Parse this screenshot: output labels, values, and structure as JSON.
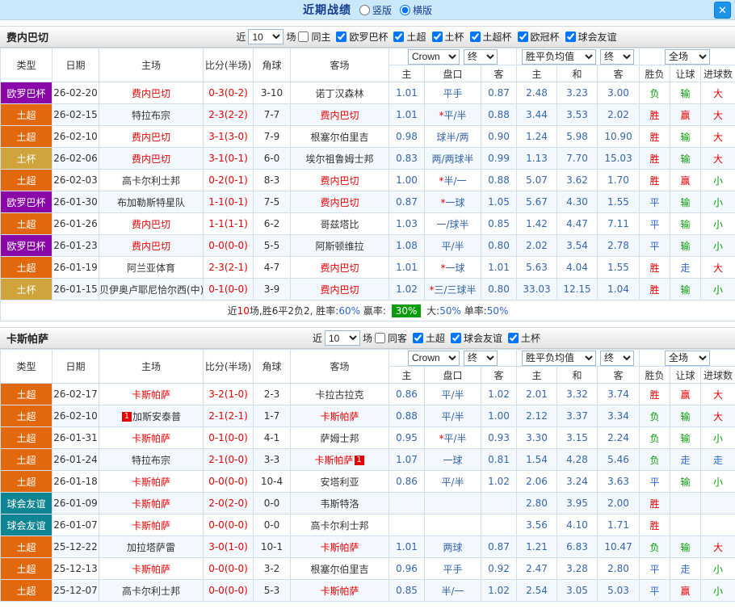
{
  "title_bar": {
    "title": "近期战绩",
    "radios": [
      {
        "label": "竖版",
        "selected": false
      },
      {
        "label": "横版",
        "selected": true
      }
    ],
    "close_glyph": "✕"
  },
  "colors": {
    "accent_blue": "#1e93ea",
    "comp_europa": "#8a08a8",
    "comp_super_lig": "#e2680e",
    "comp_cup": "#cfa43c",
    "comp_friendly": "#0f8594",
    "win_red": "#e60000",
    "lose_green": "#089b08",
    "draw_blue": "#3366cc"
  },
  "table_header": {
    "col_type": "类型",
    "col_date": "日期",
    "col_home": "主场",
    "col_score": "比分(半场)",
    "col_corner": "角球",
    "col_away": "客场",
    "dd_bookmaker": "Crown",
    "dd_final": "终",
    "dd_avg": "胜平负均值",
    "dd_full": "全场",
    "sub_home": "主",
    "sub_handicap": "盘口",
    "sub_away": "客",
    "sub_h": "主",
    "sub_d": "和",
    "sub_a": "客",
    "sub_result": "胜负",
    "sub_handi_result": "让球",
    "sub_goals": "进球数"
  },
  "sections": [
    {
      "team": "费内巴切",
      "filter": {
        "near_label": "近",
        "count": "10",
        "games_label": "场",
        "same_label": "同主",
        "same_checked": false,
        "comps": [
          "欧罗巴杯",
          "土超",
          "土杯",
          "土超杯",
          "欧冠杯",
          "球会友谊"
        ]
      },
      "rows": [
        {
          "comp": "欧罗巴杯",
          "date": "26-02-20",
          "home": "费内巴切",
          "home_hl": true,
          "home_badge": "",
          "home_badge_pos": "",
          "score": "0-3(0-2)",
          "corner": "3-10",
          "away": "诺丁汉森林",
          "away_hl": false,
          "away_badge": "",
          "away_badge_pos": "",
          "odds_home": "1.01",
          "handicap": "平手",
          "odds_away": "0.87",
          "avg_h": "2.48",
          "avg_d": "3.23",
          "avg_a": "3.00",
          "result": "负",
          "handi": "输",
          "goals": "大"
        },
        {
          "comp": "土超",
          "date": "26-02-15",
          "home": "特拉布宗",
          "home_hl": false,
          "home_badge": "",
          "home_badge_pos": "",
          "score": "2-3(2-2)",
          "corner": "7-7",
          "away": "费内巴切",
          "away_hl": true,
          "away_badge": "",
          "away_badge_pos": "",
          "odds_home": "1.01",
          "handicap": "*平/半",
          "odds_away": "0.88",
          "avg_h": "3.44",
          "avg_d": "3.53",
          "avg_a": "2.02",
          "result": "胜",
          "handi": "赢",
          "goals": "大"
        },
        {
          "comp": "土超",
          "date": "26-02-10",
          "home": "费内巴切",
          "home_hl": true,
          "home_badge": "",
          "home_badge_pos": "",
          "score": "3-1(3-0)",
          "corner": "7-9",
          "away": "根塞尔伯里吉",
          "away_hl": false,
          "away_badge": "",
          "away_badge_pos": "",
          "odds_home": "0.98",
          "handicap": "球半/两",
          "odds_away": "0.90",
          "avg_h": "1.24",
          "avg_d": "5.98",
          "avg_a": "10.90",
          "result": "胜",
          "handi": "输",
          "goals": "大"
        },
        {
          "comp": "土杯",
          "date": "26-02-06",
          "home": "费内巴切",
          "home_hl": true,
          "home_badge": "",
          "home_badge_pos": "",
          "score": "3-1(0-1)",
          "corner": "6-0",
          "away": "埃尔祖鲁姆士邦",
          "away_hl": false,
          "away_badge": "",
          "away_badge_pos": "",
          "odds_home": "0.83",
          "handicap": "两/两球半",
          "odds_away": "0.99",
          "avg_h": "1.13",
          "avg_d": "7.70",
          "avg_a": "15.03",
          "result": "胜",
          "handi": "输",
          "goals": "大"
        },
        {
          "comp": "土超",
          "date": "26-02-03",
          "home": "高卡尔利士邦",
          "home_hl": false,
          "home_badge": "",
          "home_badge_pos": "",
          "score": "0-2(0-1)",
          "corner": "8-3",
          "away": "费内巴切",
          "away_hl": true,
          "away_badge": "",
          "away_badge_pos": "",
          "odds_home": "1.00",
          "handicap": "*半/一",
          "odds_away": "0.88",
          "avg_h": "5.07",
          "avg_d": "3.62",
          "avg_a": "1.70",
          "result": "胜",
          "handi": "赢",
          "goals": "小"
        },
        {
          "comp": "欧罗巴杯",
          "date": "26-01-30",
          "home": "布加勒斯特星队",
          "home_hl": false,
          "home_badge": "",
          "home_badge_pos": "",
          "score": "1-1(0-1)",
          "corner": "7-5",
          "away": "费内巴切",
          "away_hl": true,
          "away_badge": "",
          "away_badge_pos": "",
          "odds_home": "0.87",
          "handicap": "*一球",
          "odds_away": "1.05",
          "avg_h": "5.67",
          "avg_d": "4.30",
          "avg_a": "1.55",
          "result": "平",
          "handi": "输",
          "goals": "小"
        },
        {
          "comp": "土超",
          "date": "26-01-26",
          "home": "费内巴切",
          "home_hl": true,
          "home_badge": "",
          "home_badge_pos": "",
          "score": "1-1(1-1)",
          "corner": "6-2",
          "away": "哥兹塔比",
          "away_hl": false,
          "away_badge": "",
          "away_badge_pos": "",
          "odds_home": "1.03",
          "handicap": "一/球半",
          "odds_away": "0.85",
          "avg_h": "1.42",
          "avg_d": "4.47",
          "avg_a": "7.11",
          "result": "平",
          "handi": "输",
          "goals": "小"
        },
        {
          "comp": "欧罗巴杯",
          "date": "26-01-23",
          "home": "费内巴切",
          "home_hl": true,
          "home_badge": "",
          "home_badge_pos": "",
          "score": "0-0(0-0)",
          "corner": "5-5",
          "away": "阿斯顿维拉",
          "away_hl": false,
          "away_badge": "",
          "away_badge_pos": "",
          "odds_home": "1.08",
          "handicap": "平/半",
          "odds_away": "0.80",
          "avg_h": "2.02",
          "avg_d": "3.54",
          "avg_a": "2.78",
          "result": "平",
          "handi": "输",
          "goals": "小"
        },
        {
          "comp": "土超",
          "date": "26-01-19",
          "home": "阿兰亚体育",
          "home_hl": false,
          "home_badge": "",
          "home_badge_pos": "",
          "score": "2-3(2-1)",
          "corner": "4-7",
          "away": "费内巴切",
          "away_hl": true,
          "away_badge": "",
          "away_badge_pos": "",
          "odds_home": "1.01",
          "handicap": "*一球",
          "odds_away": "1.01",
          "avg_h": "5.63",
          "avg_d": "4.04",
          "avg_a": "1.55",
          "result": "胜",
          "handi": "走",
          "goals": "大"
        },
        {
          "comp": "土杯",
          "date": "26-01-15",
          "home": "贝伊奥卢耶尼恰尔西(中)",
          "home_hl": false,
          "home_badge": "",
          "home_badge_pos": "",
          "score": "0-1(0-0)",
          "corner": "3-9",
          "away": "费内巴切",
          "away_hl": true,
          "away_badge": "",
          "away_badge_pos": "",
          "odds_home": "1.02",
          "handicap": "*三/三球半",
          "odds_away": "0.80",
          "avg_h": "33.03",
          "avg_d": "12.15",
          "avg_a": "1.04",
          "result": "胜",
          "handi": "输",
          "goals": "小"
        }
      ],
      "summary": [
        {
          "text": "近",
          "style": "plain"
        },
        {
          "text": "10",
          "style": "red"
        },
        {
          "text": "场,胜6平2负2, 胜率:",
          "style": "plain"
        },
        {
          "text": "60%",
          "style": "blue"
        },
        {
          "text": " 赢率: ",
          "style": "plain"
        },
        {
          "text": "30%",
          "style": "green-badge"
        },
        {
          "text": " 大:",
          "style": "plain"
        },
        {
          "text": "50%",
          "style": "blue"
        },
        {
          "text": " 单率:",
          "style": "plain"
        },
        {
          "text": "50%",
          "style": "blue"
        }
      ]
    },
    {
      "team": "卡斯帕萨",
      "filter": {
        "near_label": "近",
        "count": "10",
        "games_label": "场",
        "same_label": "同客",
        "same_checked": false,
        "comps": [
          "土超",
          "球会友谊",
          "土杯"
        ]
      },
      "rows": [
        {
          "comp": "土超",
          "date": "26-02-17",
          "home": "卡斯帕萨",
          "home_hl": true,
          "home_badge": "",
          "home_badge_pos": "",
          "score": "3-2(1-0)",
          "corner": "2-3",
          "away": "卡拉古拉克",
          "away_hl": false,
          "away_badge": "",
          "away_badge_pos": "",
          "odds_home": "0.86",
          "handicap": "平/半",
          "odds_away": "1.02",
          "avg_h": "2.01",
          "avg_d": "3.32",
          "avg_a": "3.74",
          "result": "胜",
          "handi": "赢",
          "goals": "大"
        },
        {
          "comp": "土超",
          "date": "26-02-10",
          "home": "加斯安泰普",
          "home_hl": false,
          "home_badge": "1",
          "home_badge_pos": "before",
          "score": "2-1(2-1)",
          "corner": "1-7",
          "away": "卡斯帕萨",
          "away_hl": true,
          "away_badge": "",
          "away_badge_pos": "",
          "odds_home": "0.88",
          "handicap": "平/半",
          "odds_away": "1.00",
          "avg_h": "2.12",
          "avg_d": "3.37",
          "avg_a": "3.34",
          "result": "负",
          "handi": "输",
          "goals": "大"
        },
        {
          "comp": "土超",
          "date": "26-01-31",
          "home": "卡斯帕萨",
          "home_hl": true,
          "home_badge": "",
          "home_badge_pos": "",
          "score": "0-1(0-0)",
          "corner": "4-1",
          "away": "萨姆士邦",
          "away_hl": false,
          "away_badge": "",
          "away_badge_pos": "",
          "odds_home": "0.95",
          "handicap": "*平/半",
          "odds_away": "0.93",
          "avg_h": "3.30",
          "avg_d": "3.15",
          "avg_a": "2.24",
          "result": "负",
          "handi": "输",
          "goals": "小"
        },
        {
          "comp": "土超",
          "date": "26-01-24",
          "home": "特拉布宗",
          "home_hl": false,
          "home_badge": "",
          "home_badge_pos": "",
          "score": "2-1(0-0)",
          "corner": "3-3",
          "away": "卡斯帕萨",
          "away_hl": true,
          "away_badge": "1",
          "away_badge_pos": "after",
          "odds_home": "1.07",
          "handicap": "一球",
          "odds_away": "0.81",
          "avg_h": "1.54",
          "avg_d": "4.28",
          "avg_a": "5.46",
          "result": "负",
          "handi": "走",
          "goals": "走"
        },
        {
          "comp": "土超",
          "date": "26-01-18",
          "home": "卡斯帕萨",
          "home_hl": true,
          "home_badge": "",
          "home_badge_pos": "",
          "score": "0-0(0-0)",
          "corner": "10-4",
          "away": "安塔利亚",
          "away_hl": false,
          "away_badge": "",
          "away_badge_pos": "",
          "odds_home": "0.86",
          "handicap": "平/半",
          "odds_away": "1.02",
          "avg_h": "2.06",
          "avg_d": "3.24",
          "avg_a": "3.63",
          "result": "平",
          "handi": "输",
          "goals": "小"
        },
        {
          "comp": "球会友谊",
          "date": "26-01-09",
          "home": "卡斯帕萨",
          "home_hl": true,
          "home_badge": "",
          "home_badge_pos": "",
          "score": "2-0(2-0)",
          "corner": "0-0",
          "away": "韦斯特洛",
          "away_hl": false,
          "away_badge": "",
          "away_badge_pos": "",
          "odds_home": "",
          "handicap": "",
          "odds_away": "",
          "avg_h": "2.80",
          "avg_d": "3.95",
          "avg_a": "2.00",
          "result": "胜",
          "handi": "",
          "goals": ""
        },
        {
          "comp": "球会友谊",
          "date": "26-01-07",
          "home": "卡斯帕萨",
          "home_hl": true,
          "home_badge": "",
          "home_badge_pos": "",
          "score": "0-0(0-0)",
          "corner": "0-0",
          "away": "高卡尔利士邦",
          "away_hl": false,
          "away_badge": "",
          "away_badge_pos": "",
          "odds_home": "",
          "handicap": "",
          "odds_away": "",
          "avg_h": "3.56",
          "avg_d": "4.10",
          "avg_a": "1.71",
          "result": "胜",
          "handi": "",
          "goals": ""
        },
        {
          "comp": "土超",
          "date": "25-12-22",
          "home": "加拉塔萨雷",
          "home_hl": false,
          "home_badge": "",
          "home_badge_pos": "",
          "score": "3-0(1-0)",
          "corner": "10-1",
          "away": "卡斯帕萨",
          "away_hl": true,
          "away_badge": "",
          "away_badge_pos": "",
          "odds_home": "1.01",
          "handicap": "两球",
          "odds_away": "0.87",
          "avg_h": "1.21",
          "avg_d": "6.83",
          "avg_a": "10.47",
          "result": "负",
          "handi": "输",
          "goals": "大"
        },
        {
          "comp": "土超",
          "date": "25-12-13",
          "home": "卡斯帕萨",
          "home_hl": true,
          "home_badge": "",
          "home_badge_pos": "",
          "score": "0-0(0-0)",
          "corner": "3-2",
          "away": "根塞尔伯里吉",
          "away_hl": false,
          "away_badge": "",
          "away_badge_pos": "",
          "odds_home": "0.96",
          "handicap": "平手",
          "odds_away": "0.92",
          "avg_h": "2.47",
          "avg_d": "3.28",
          "avg_a": "2.80",
          "result": "平",
          "handi": "走",
          "goals": "小"
        },
        {
          "comp": "土超",
          "date": "25-12-07",
          "home": "高卡尔利士邦",
          "home_hl": false,
          "home_badge": "",
          "home_badge_pos": "",
          "score": "0-0(0-0)",
          "corner": "5-3",
          "away": "卡斯帕萨",
          "away_hl": true,
          "away_badge": "",
          "away_badge_pos": "",
          "odds_home": "0.85",
          "handicap": "半/一",
          "odds_away": "1.02",
          "avg_h": "2.54",
          "avg_d": "3.05",
          "avg_a": "5.03",
          "result": "平",
          "handi": "赢",
          "goals": "小"
        }
      ],
      "summary": []
    }
  ]
}
